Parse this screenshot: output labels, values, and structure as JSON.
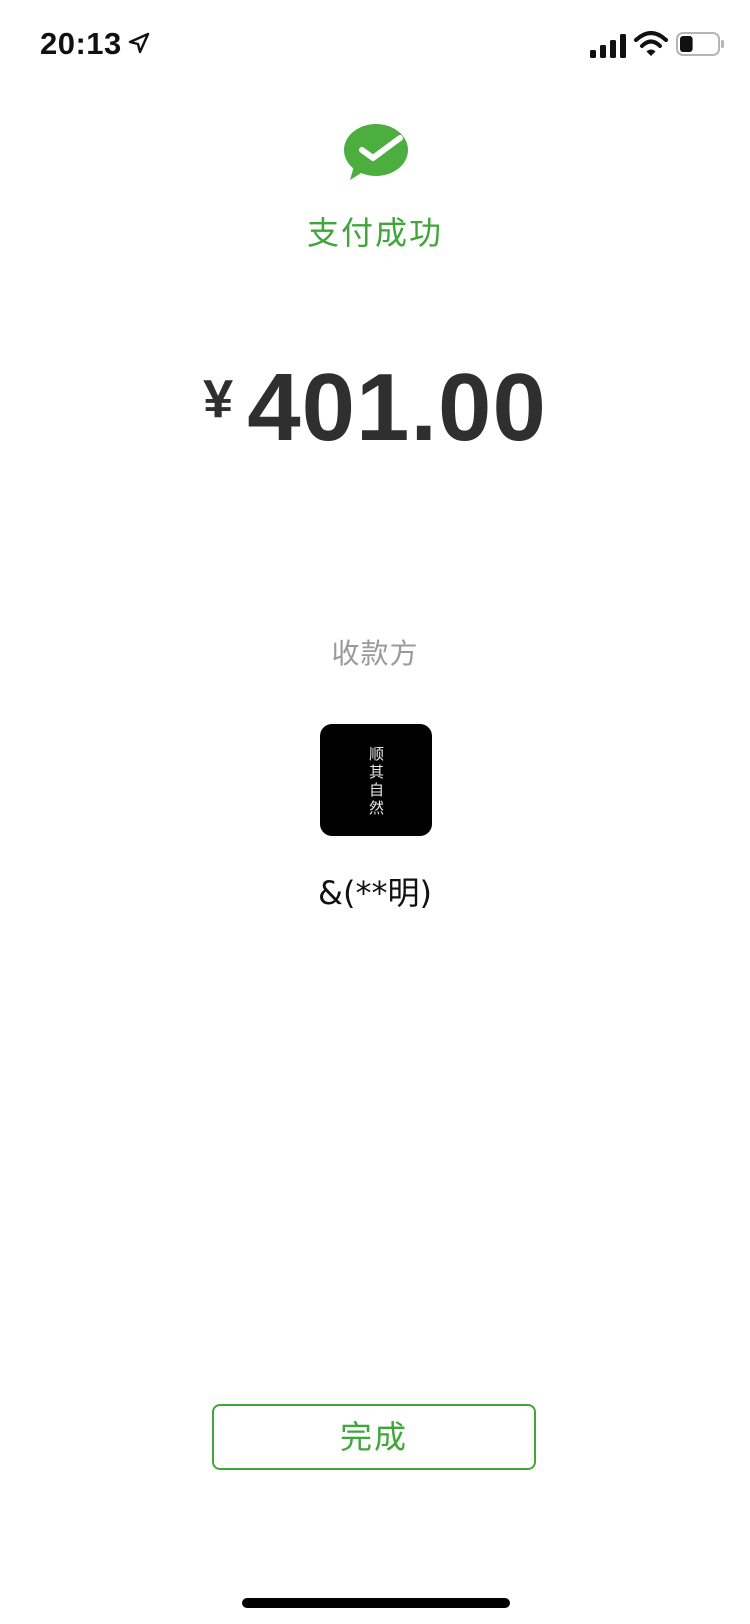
{
  "status_bar": {
    "time": "20:13",
    "location_icon": "location-arrow-icon",
    "signal_icon": "cellular-signal-icon",
    "wifi_icon": "wifi-icon",
    "battery_icon": "battery-icon",
    "battery_level": 0.35
  },
  "header": {
    "logo_icon": "wechat-pay-icon",
    "title": "支付成功"
  },
  "payment": {
    "currency_symbol": "¥",
    "amount": "401.00"
  },
  "payee": {
    "label": "收款方",
    "avatar_text": "顺其自然",
    "name": "&(**明)"
  },
  "actions": {
    "done_label": "完成"
  },
  "colors": {
    "brand_green": "#3fa63a",
    "amount_text": "#2f2f2f",
    "muted_text": "#9a9a9a"
  }
}
